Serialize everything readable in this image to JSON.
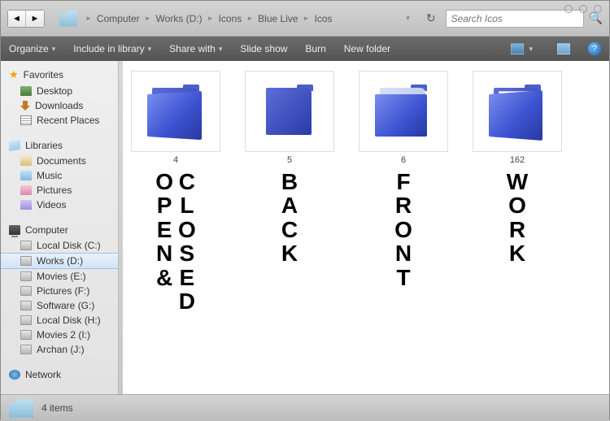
{
  "window_controls": [
    "min",
    "max",
    "close"
  ],
  "breadcrumb": [
    "Computer",
    "Works (D:)",
    "Icons",
    "Blue Live",
    "Icos"
  ],
  "search": {
    "placeholder": "Search Icos"
  },
  "toolbar": {
    "organize": "Organize",
    "include": "Include in library",
    "share": "Share with",
    "slideshow": "Slide show",
    "burn": "Burn",
    "newfolder": "New folder"
  },
  "sidebar": {
    "favorites": {
      "label": "Favorites",
      "items": [
        "Desktop",
        "Downloads",
        "Recent Places"
      ]
    },
    "libraries": {
      "label": "Libraries",
      "items": [
        "Documents",
        "Music",
        "Pictures",
        "Videos"
      ]
    },
    "computer": {
      "label": "Computer",
      "items": [
        "Local Disk (C:)",
        "Works (D:)",
        "Movies (E:)",
        "Pictures (F:)",
        "Software (G:)",
        "Local Disk (H:)",
        "Movies 2 (I:)",
        "Archan (J:)"
      ],
      "selected": 1
    },
    "network": {
      "label": "Network"
    }
  },
  "thumbs": [
    {
      "num": "4",
      "letters": [
        "OPEN&",
        "CLOSED"
      ],
      "kind": "open"
    },
    {
      "num": "5",
      "letters": [
        "BACK"
      ],
      "kind": "back-only"
    },
    {
      "num": "6",
      "letters": [
        "FRONT"
      ],
      "kind": "front-only"
    },
    {
      "num": "162",
      "letters": [
        "WORK"
      ],
      "kind": "work"
    }
  ],
  "status": {
    "count": "4 items"
  }
}
